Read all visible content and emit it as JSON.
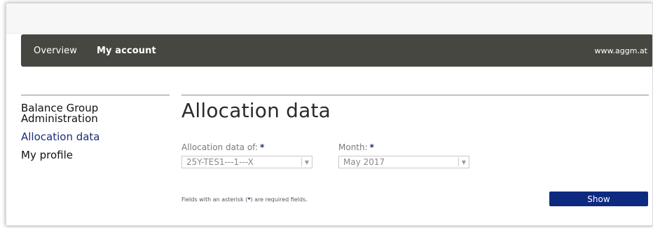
{
  "nav": {
    "items": [
      "Overview",
      "My account"
    ],
    "site": "www.aggm.at"
  },
  "sidebar": {
    "items": [
      {
        "label": "Balance Group Administration"
      },
      {
        "label": "Allocation data"
      },
      {
        "label": "My profile"
      }
    ]
  },
  "main": {
    "title": "Allocation data",
    "allocation_field": {
      "label": "Allocation data of:",
      "value": "25Y-TES1---1---X"
    },
    "month_field": {
      "label": "Month:",
      "value": "May 2017"
    },
    "required_marker": "*",
    "note": {
      "before": "Fields with an asterisk (",
      "after": ") are required fields."
    },
    "show_button": "Show"
  },
  "colors": {
    "nav_bg": "#474741",
    "accent": "#1b2e78",
    "button": "#0e2a80"
  }
}
